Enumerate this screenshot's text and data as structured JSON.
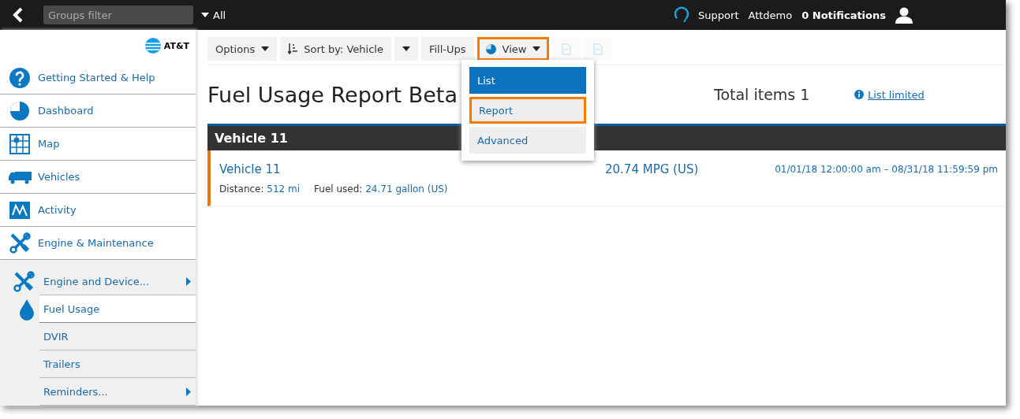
{
  "top_bar": {
    "groups_filter": {
      "placeholder": "Groups filter"
    },
    "groups_scope": "All",
    "support": "Support",
    "account": "Attdemo",
    "notifications": "0 Notifications"
  },
  "sidebar": {
    "brand": "AT&T",
    "items": [
      {
        "label": "Getting Started & Help",
        "kind": "help",
        "selected": false
      },
      {
        "label": "Dashboard",
        "kind": "pie",
        "selected": false
      },
      {
        "label": "Map",
        "kind": "map",
        "selected": false
      },
      {
        "label": "Vehicles",
        "kind": "truck",
        "selected": false
      },
      {
        "label": "Activity",
        "kind": "activity",
        "selected": false
      },
      {
        "label": "Engine & Maintenance",
        "kind": "tools",
        "selected": false,
        "expanded": true,
        "children": [
          {
            "label": "Engine and Device...",
            "kind": "tools",
            "submenu": true,
            "selected": false
          },
          {
            "label": "Fuel Usage",
            "kind": "drop",
            "submenu": false,
            "selected": true
          },
          {
            "label": "DVIR",
            "submenu": false,
            "selected": false
          },
          {
            "label": "Trailers",
            "submenu": false,
            "selected": false
          },
          {
            "label": "Reminders...",
            "submenu": true,
            "selected": false
          }
        ]
      }
    ]
  },
  "toolbar": {
    "options": "Options",
    "sort": "Sort by: Vehicle",
    "fillups": "Fill-Ups",
    "view": {
      "label": "View",
      "highlighted": true
    },
    "view_menu": [
      {
        "label": "List",
        "selected": true,
        "highlighted": false
      },
      {
        "label": "Report",
        "selected": false,
        "highlighted": true
      },
      {
        "label": "Advanced",
        "selected": false,
        "highlighted": false
      }
    ]
  },
  "report": {
    "title": "Fuel Usage Report Beta",
    "total": "Total items 1",
    "list_limited": "List limited",
    "groups": [
      {
        "name": "Vehicle 11",
        "rows": [
          {
            "vehicle": "Vehicle 11",
            "economy": "20.74 MPG (US)",
            "period": "01/01/18 12:00:00 am – 08/31/18 11:59:59 pm",
            "distance_label": "Distance:",
            "distance": "512 mi",
            "fuel_label": "Fuel used:",
            "fuel": "24.71 gallon (US)"
          }
        ]
      }
    ]
  }
}
